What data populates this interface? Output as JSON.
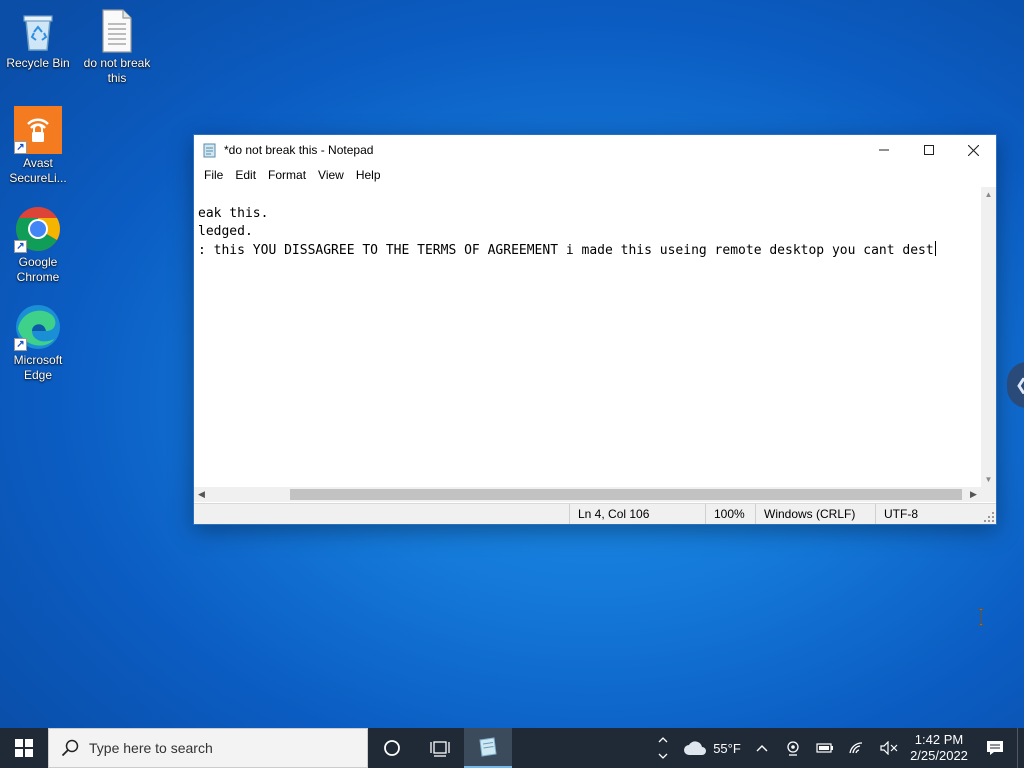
{
  "desktop": {
    "icons": [
      {
        "label": "Recycle Bin"
      },
      {
        "label": "do not break this"
      },
      {
        "label": "Avast SecureLi..."
      },
      {
        "label": "Google Chrome"
      },
      {
        "label": "Microsoft Edge"
      }
    ]
  },
  "notepad": {
    "title": "*do not break this - Notepad",
    "menu": [
      "File",
      "Edit",
      "Format",
      "View",
      "Help"
    ],
    "lines": [
      "eak this.",
      "ledged.",
      ": this YOU DISSAGREE TO THE TERMS OF AGREEMENT i made this useing remote desktop you cant dest"
    ],
    "status": {
      "position": "Ln 4, Col 106",
      "zoom": "100%",
      "line_ending": "Windows (CRLF)",
      "encoding": "UTF-8"
    }
  },
  "taskbar": {
    "search_placeholder": "Type here to search",
    "weather": "55°F",
    "time": "1:42 PM",
    "date": "2/25/2022"
  },
  "colors": {
    "desktop_blue": "#1478d8",
    "taskbar": "#1f2a36",
    "avast_orange": "#f47b20"
  }
}
